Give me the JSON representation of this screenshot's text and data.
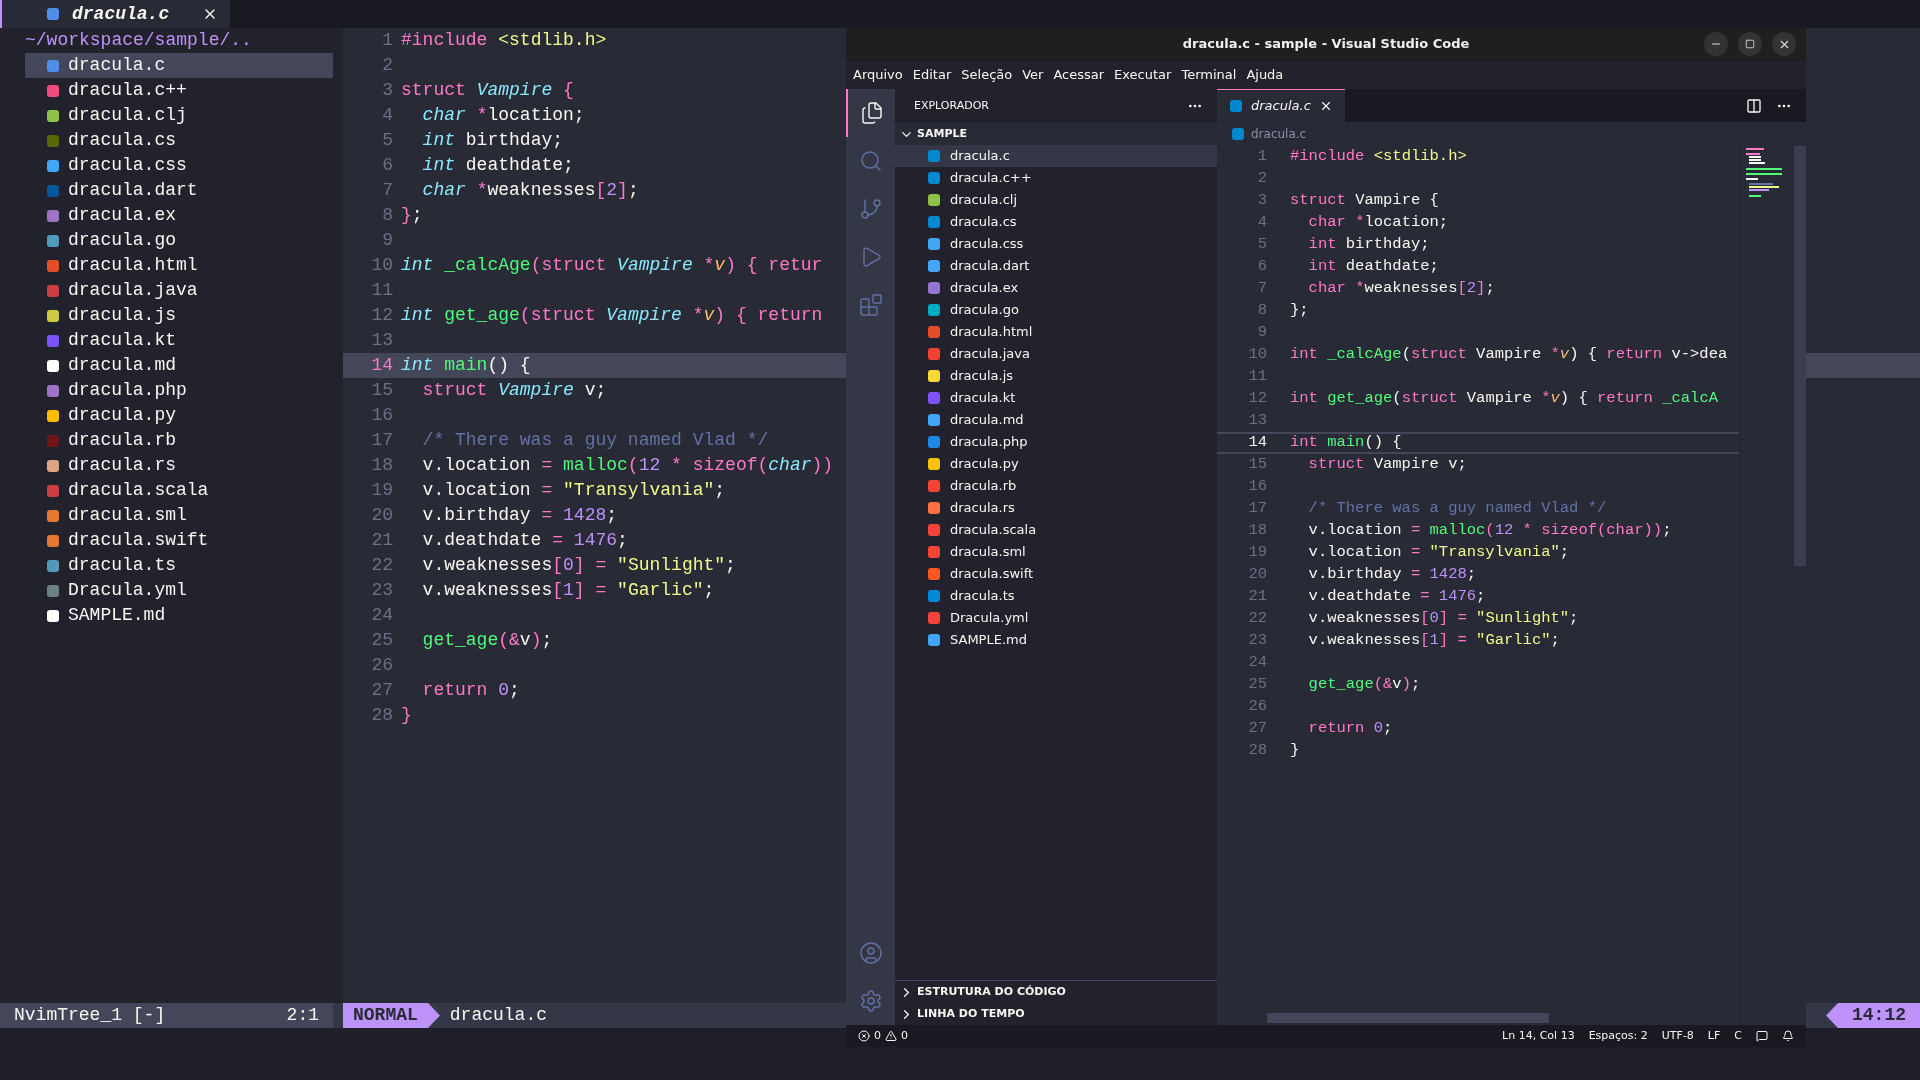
{
  "nvim": {
    "tab": {
      "title": "dracula.c"
    },
    "tree": {
      "root": "~/workspace/sample/..",
      "items": [
        {
          "name": "dracula.c",
          "color": "#4f8fe8",
          "selected": true
        },
        {
          "name": "dracula.c++",
          "color": "#f34b7d",
          "selected": false
        },
        {
          "name": "dracula.clj",
          "color": "#8dc149",
          "selected": false
        },
        {
          "name": "dracula.cs",
          "color": "#596706",
          "selected": false
        },
        {
          "name": "dracula.css",
          "color": "#42a5f5",
          "selected": false
        },
        {
          "name": "dracula.dart",
          "color": "#03589c",
          "selected": false
        },
        {
          "name": "dracula.ex",
          "color": "#a074c4",
          "selected": false
        },
        {
          "name": "dracula.go",
          "color": "#519aba",
          "selected": false
        },
        {
          "name": "dracula.html",
          "color": "#e44d26",
          "selected": false
        },
        {
          "name": "dracula.java",
          "color": "#cc3e44",
          "selected": false
        },
        {
          "name": "dracula.js",
          "color": "#cbcb41",
          "selected": false
        },
        {
          "name": "dracula.kt",
          "color": "#7f52ff",
          "selected": false
        },
        {
          "name": "dracula.md",
          "color": "#ffffff",
          "selected": false
        },
        {
          "name": "dracula.php",
          "color": "#a074c4",
          "selected": false
        },
        {
          "name": "dracula.py",
          "color": "#ffbc03",
          "selected": false
        },
        {
          "name": "dracula.rb",
          "color": "#701516",
          "selected": false
        },
        {
          "name": "dracula.rs",
          "color": "#dea584",
          "selected": false
        },
        {
          "name": "dracula.scala",
          "color": "#cc3e44",
          "selected": false
        },
        {
          "name": "dracula.sml",
          "color": "#e37933",
          "selected": false
        },
        {
          "name": "dracula.swift",
          "color": "#e37933",
          "selected": false
        },
        {
          "name": "dracula.ts",
          "color": "#519aba",
          "selected": false
        },
        {
          "name": "Dracula.yml",
          "color": "#6d8086",
          "selected": false
        },
        {
          "name": "SAMPLE.md",
          "color": "#fffffe",
          "selected": false
        }
      ]
    },
    "lines": [
      {
        "number": "1",
        "current": false,
        "tokens": [
          {
            "kind": "keyword",
            "text": "#include"
          },
          {
            "kind": "string",
            "text": " <stdlib.h>"
          }
        ]
      },
      {
        "number": "2",
        "current": false
      },
      {
        "number": "3",
        "current": false,
        "tokens": [
          {
            "kind": "keyword",
            "text": "struct "
          },
          {
            "kind": "class",
            "text": "Vampire "
          },
          {
            "kind": "operator",
            "text": "{"
          }
        ]
      },
      {
        "number": "4",
        "current": false,
        "tokens": [
          {
            "kind": "type",
            "text": "  char "
          },
          {
            "kind": "operator",
            "text": "*"
          },
          {
            "kind": "plain",
            "text": "location;"
          }
        ]
      },
      {
        "number": "5",
        "current": false,
        "tokens": [
          {
            "kind": "type",
            "text": "  int"
          },
          {
            "kind": "plain",
            "text": " birthday;"
          }
        ]
      },
      {
        "number": "6",
        "current": false,
        "tokens": [
          {
            "kind": "type",
            "text": "  int"
          },
          {
            "kind": "plain",
            "text": " deathdate;"
          }
        ]
      },
      {
        "number": "7",
        "current": false,
        "tokens": [
          {
            "kind": "type",
            "text": "  char "
          },
          {
            "kind": "operator",
            "text": "*"
          },
          {
            "kind": "plain",
            "text": "weaknesses"
          },
          {
            "kind": "operator",
            "text": "["
          },
          {
            "kind": "number",
            "text": "2"
          },
          {
            "kind": "operator",
            "text": "]"
          },
          {
            "kind": "plain",
            "text": ";"
          }
        ]
      },
      {
        "number": "8",
        "current": false,
        "tokens": [
          {
            "kind": "operator",
            "text": "}"
          },
          {
            "kind": "plain",
            "text": ";"
          }
        ]
      },
      {
        "number": "9",
        "current": false
      },
      {
        "number": "10",
        "current": false,
        "tokens": [
          {
            "kind": "type",
            "text": "int "
          },
          {
            "kind": "function",
            "text": "_calcAge"
          },
          {
            "kind": "operator",
            "text": "("
          },
          {
            "kind": "keyword",
            "text": "struct "
          },
          {
            "kind": "class",
            "text": "Vampire "
          },
          {
            "kind": "operator",
            "text": "*"
          },
          {
            "kind": "param",
            "text": "v"
          },
          {
            "kind": "operator",
            "text": ") { "
          },
          {
            "kind": "keyword",
            "text": "retur"
          }
        ]
      },
      {
        "number": "11",
        "current": false
      },
      {
        "number": "12",
        "current": false,
        "tokens": [
          {
            "kind": "type",
            "text": "int "
          },
          {
            "kind": "function",
            "text": "get_age"
          },
          {
            "kind": "operator",
            "text": "("
          },
          {
            "kind": "keyword",
            "text": "struct "
          },
          {
            "kind": "class",
            "text": "Vampire "
          },
          {
            "kind": "operator",
            "text": "*"
          },
          {
            "kind": "param",
            "text": "v"
          },
          {
            "kind": "operator",
            "text": ") { "
          },
          {
            "kind": "keyword",
            "text": "return"
          }
        ]
      },
      {
        "number": "13",
        "current": false
      },
      {
        "number": "14",
        "current": true,
        "tokens": [
          {
            "kind": "type",
            "text": "int "
          },
          {
            "kind": "function",
            "text": "main"
          },
          {
            "kind": "plain",
            "text": "() {"
          }
        ]
      },
      {
        "number": "15",
        "current": false,
        "tokens": [
          {
            "kind": "keyword",
            "text": "  struct "
          },
          {
            "kind": "class",
            "text": "Vampire"
          },
          {
            "kind": "plain",
            "text": " v;"
          }
        ]
      },
      {
        "number": "16",
        "current": false
      },
      {
        "number": "17",
        "current": false,
        "tokens": [
          {
            "kind": "comment",
            "text": "  /* There was a guy named Vlad */"
          }
        ]
      },
      {
        "number": "18",
        "current": false,
        "tokens": [
          {
            "kind": "plain",
            "text": "  v.location "
          },
          {
            "kind": "operator",
            "text": "= "
          },
          {
            "kind": "function",
            "text": "malloc"
          },
          {
            "kind": "operator",
            "text": "("
          },
          {
            "kind": "number",
            "text": "12"
          },
          {
            "kind": "operator",
            "text": " * "
          },
          {
            "kind": "keyword",
            "text": "sizeof"
          },
          {
            "kind": "operator",
            "text": "("
          },
          {
            "kind": "type",
            "text": "char"
          },
          {
            "kind": "operator",
            "text": "))"
          }
        ]
      },
      {
        "number": "19",
        "current": false,
        "tokens": [
          {
            "kind": "plain",
            "text": "  v.location "
          },
          {
            "kind": "operator",
            "text": "= "
          },
          {
            "kind": "string",
            "text": "\"Transylvania\""
          },
          {
            "kind": "plain",
            "text": ";"
          }
        ]
      },
      {
        "number": "20",
        "current": false,
        "tokens": [
          {
            "kind": "plain",
            "text": "  v.birthday "
          },
          {
            "kind": "operator",
            "text": "= "
          },
          {
            "kind": "number",
            "text": "1428"
          },
          {
            "kind": "plain",
            "text": ";"
          }
        ]
      },
      {
        "number": "21",
        "current": false,
        "tokens": [
          {
            "kind": "plain",
            "text": "  v.deathdate "
          },
          {
            "kind": "operator",
            "text": "= "
          },
          {
            "kind": "number",
            "text": "1476"
          },
          {
            "kind": "plain",
            "text": ";"
          }
        ]
      },
      {
        "number": "22",
        "current": false,
        "tokens": [
          {
            "kind": "plain",
            "text": "  v.weaknesses"
          },
          {
            "kind": "operator",
            "text": "["
          },
          {
            "kind": "number",
            "text": "0"
          },
          {
            "kind": "operator",
            "text": "] = "
          },
          {
            "kind": "string",
            "text": "\"Sunlight\""
          },
          {
            "kind": "plain",
            "text": ";"
          }
        ]
      },
      {
        "number": "23",
        "current": false,
        "tokens": [
          {
            "kind": "plain",
            "text": "  v.weaknesses"
          },
          {
            "kind": "operator",
            "text": "["
          },
          {
            "kind": "number",
            "text": "1"
          },
          {
            "kind": "operator",
            "text": "] = "
          },
          {
            "kind": "string",
            "text": "\"Garlic\""
          },
          {
            "kind": "plain",
            "text": ";"
          }
        ]
      },
      {
        "number": "24",
        "current": false
      },
      {
        "number": "25",
        "current": false,
        "tokens": [
          {
            "kind": "function",
            "text": "  get_age"
          },
          {
            "kind": "operator",
            "text": "(&"
          },
          {
            "kind": "plain",
            "text": "v"
          },
          {
            "kind": "operator",
            "text": ")"
          },
          {
            "kind": "plain",
            "text": ";"
          }
        ]
      },
      {
        "number": "26",
        "current": false
      },
      {
        "number": "27",
        "current": false,
        "tokens": [
          {
            "kind": "keyword",
            "text": "  return "
          },
          {
            "kind": "number",
            "text": "0"
          },
          {
            "kind": "plain",
            "text": ";"
          }
        ]
      },
      {
        "number": "28",
        "current": false,
        "tokens": [
          {
            "kind": "operator",
            "text": "}"
          }
        ]
      }
    ],
    "status": {
      "tree_name": "NvimTree_1 [-]",
      "tree_position": "2:1",
      "mode": "NORMAL",
      "file": "dracula.c",
      "position": "14:12"
    }
  },
  "vscode": {
    "title": "dracula.c - sample - Visual Studio Code",
    "menu": [
      "Arquivo",
      "Editar",
      "Seleção",
      "Ver",
      "Acessar",
      "Executar",
      "Terminal",
      "Ajuda"
    ],
    "explorer": {
      "title": "EXPLORADOR",
      "folder": "SAMPLE",
      "expanded": true,
      "items": [
        {
          "name": "dracula.c",
          "color": "#0288d1",
          "selected": true
        },
        {
          "name": "dracula.c++",
          "color": "#0288d2",
          "selected": false
        },
        {
          "name": "dracula.clj",
          "color": "#8dc149",
          "selected": false
        },
        {
          "name": "dracula.cs",
          "color": "#0288d3",
          "selected": false
        },
        {
          "name": "dracula.css",
          "color": "#42a5f5",
          "selected": false
        },
        {
          "name": "dracula.dart",
          "color": "#42a5f6",
          "selected": false
        },
        {
          "name": "dracula.ex",
          "color": "#9575cd",
          "selected": false
        },
        {
          "name": "dracula.go",
          "color": "#00acc1",
          "selected": false
        },
        {
          "name": "dracula.html",
          "color": "#e44d26",
          "selected": false
        },
        {
          "name": "dracula.java",
          "color": "#f44336",
          "selected": false
        },
        {
          "name": "dracula.js",
          "color": "#fdd835",
          "selected": false
        },
        {
          "name": "dracula.kt",
          "color": "#7f52ff",
          "selected": false
        },
        {
          "name": "dracula.md",
          "color": "#42a5f7",
          "selected": false
        },
        {
          "name": "dracula.php",
          "color": "#1e88e5",
          "selected": false
        },
        {
          "name": "dracula.py",
          "color": "#ffc107",
          "selected": false
        },
        {
          "name": "dracula.rb",
          "color": "#f44337",
          "selected": false
        },
        {
          "name": "dracula.rs",
          "color": "#ff7043",
          "selected": false
        },
        {
          "name": "dracula.scala",
          "color": "#f44338",
          "selected": false
        },
        {
          "name": "dracula.sml",
          "color": "#f44339",
          "selected": false
        },
        {
          "name": "dracula.swift",
          "color": "#ff5722",
          "selected": false
        },
        {
          "name": "dracula.ts",
          "color": "#0288d4",
          "selected": false
        },
        {
          "name": "Dracula.yml",
          "color": "#f4433a",
          "selected": false
        },
        {
          "name": "SAMPLE.md",
          "color": "#42a5f8",
          "selected": false
        }
      ]
    },
    "sections": [
      {
        "label": "ESTRUTURA DO CÓDIGO",
        "expanded": false
      },
      {
        "label": "LINHA DO TEMPO",
        "expanded": false
      }
    ],
    "tab": {
      "title": "dracula.c"
    },
    "breadcrumb": "dracula.c",
    "lines": [
      {
        "number": "1",
        "current": false,
        "tokens": [
          {
            "kind": "keyword",
            "text": "#include"
          },
          {
            "kind": "string",
            "text": " <stdlib.h>"
          }
        ]
      },
      {
        "number": "2",
        "current": false
      },
      {
        "number": "3",
        "current": false,
        "tokens": [
          {
            "kind": "keyword",
            "text": "struct "
          },
          {
            "kind": "class",
            "text": "Vampire {"
          }
        ]
      },
      {
        "number": "4",
        "current": false,
        "tokens": [
          {
            "kind": "type",
            "text": "  char "
          },
          {
            "kind": "operator",
            "text": "*"
          },
          {
            "kind": "plain",
            "text": "location;"
          }
        ]
      },
      {
        "number": "5",
        "current": false,
        "tokens": [
          {
            "kind": "type",
            "text": "  int"
          },
          {
            "kind": "plain",
            "text": " birthday;"
          }
        ]
      },
      {
        "number": "6",
        "current": false,
        "tokens": [
          {
            "kind": "type",
            "text": "  int"
          },
          {
            "kind": "plain",
            "text": " deathdate;"
          }
        ]
      },
      {
        "number": "7",
        "current": false,
        "tokens": [
          {
            "kind": "type",
            "text": "  char "
          },
          {
            "kind": "operator",
            "text": "*"
          },
          {
            "kind": "plain",
            "text": "weaknesses"
          },
          {
            "kind": "operator",
            "text": "["
          },
          {
            "kind": "number",
            "text": "2"
          },
          {
            "kind": "operator",
            "text": "]"
          },
          {
            "kind": "plain",
            "text": ";"
          }
        ]
      },
      {
        "number": "8",
        "current": false,
        "tokens": [
          {
            "kind": "plain",
            "text": "};"
          }
        ]
      },
      {
        "number": "9",
        "current": false
      },
      {
        "number": "10",
        "current": false,
        "tokens": [
          {
            "kind": "type",
            "text": "int "
          },
          {
            "kind": "function",
            "text": "_calcAge"
          },
          {
            "kind": "plain",
            "text": "("
          },
          {
            "kind": "keyword",
            "text": "struct "
          },
          {
            "kind": "class",
            "text": "Vampire "
          },
          {
            "kind": "operator",
            "text": "*"
          },
          {
            "kind": "param",
            "text": "v"
          },
          {
            "kind": "plain",
            "text": ") { "
          },
          {
            "kind": "keyword",
            "text": "return"
          },
          {
            "kind": "plain",
            "text": " v->dea"
          }
        ]
      },
      {
        "number": "11",
        "current": false
      },
      {
        "number": "12",
        "current": false,
        "tokens": [
          {
            "kind": "type",
            "text": "int "
          },
          {
            "kind": "function",
            "text": "get_age"
          },
          {
            "kind": "plain",
            "text": "("
          },
          {
            "kind": "keyword",
            "text": "struct "
          },
          {
            "kind": "class",
            "text": "Vampire "
          },
          {
            "kind": "operator",
            "text": "*"
          },
          {
            "kind": "param",
            "text": "v"
          },
          {
            "kind": "plain",
            "text": ") { "
          },
          {
            "kind": "keyword",
            "text": "return "
          },
          {
            "kind": "function",
            "text": "_calcA"
          }
        ]
      },
      {
        "number": "13",
        "current": false
      },
      {
        "number": "14",
        "current": true,
        "tokens": [
          {
            "kind": "type",
            "text": "int "
          },
          {
            "kind": "function",
            "text": "main"
          },
          {
            "kind": "plain",
            "text": "() {"
          }
        ]
      },
      {
        "number": "15",
        "current": false,
        "tokens": [
          {
            "kind": "keyword",
            "text": "  struct "
          },
          {
            "kind": "class",
            "text": "Vampire"
          },
          {
            "kind": "plain",
            "text": " v;"
          }
        ]
      },
      {
        "number": "16",
        "current": false
      },
      {
        "number": "17",
        "current": false,
        "tokens": [
          {
            "kind": "comment",
            "text": "  /* There was a guy named Vlad */"
          }
        ]
      },
      {
        "number": "18",
        "current": false,
        "tokens": [
          {
            "kind": "plain",
            "text": "  v.location "
          },
          {
            "kind": "operator",
            "text": "= "
          },
          {
            "kind": "function",
            "text": "malloc"
          },
          {
            "kind": "operator",
            "text": "("
          },
          {
            "kind": "number",
            "text": "12"
          },
          {
            "kind": "operator",
            "text": " * "
          },
          {
            "kind": "keyword",
            "text": "sizeof"
          },
          {
            "kind": "operator",
            "text": "("
          },
          {
            "kind": "keyword",
            "text": "char"
          },
          {
            "kind": "operator",
            "text": "))"
          },
          {
            "kind": "plain",
            "text": ";"
          }
        ]
      },
      {
        "number": "19",
        "current": false,
        "tokens": [
          {
            "kind": "plain",
            "text": "  v.location "
          },
          {
            "kind": "operator",
            "text": "= "
          },
          {
            "kind": "string",
            "text": "\"Transylvania\""
          },
          {
            "kind": "plain",
            "text": ";"
          }
        ]
      },
      {
        "number": "20",
        "current": false,
        "tokens": [
          {
            "kind": "plain",
            "text": "  v.birthday "
          },
          {
            "kind": "operator",
            "text": "= "
          },
          {
            "kind": "number",
            "text": "1428"
          },
          {
            "kind": "plain",
            "text": ";"
          }
        ]
      },
      {
        "number": "21",
        "current": false,
        "tokens": [
          {
            "kind": "plain",
            "text": "  v.deathdate "
          },
          {
            "kind": "operator",
            "text": "= "
          },
          {
            "kind": "number",
            "text": "1476"
          },
          {
            "kind": "plain",
            "text": ";"
          }
        ]
      },
      {
        "number": "22",
        "current": false,
        "tokens": [
          {
            "kind": "plain",
            "text": "  v.weaknesses"
          },
          {
            "kind": "operator",
            "text": "["
          },
          {
            "kind": "number",
            "text": "0"
          },
          {
            "kind": "operator",
            "text": "] = "
          },
          {
            "kind": "string",
            "text": "\"Sunlight\""
          },
          {
            "kind": "plain",
            "text": ";"
          }
        ]
      },
      {
        "number": "23",
        "current": false,
        "tokens": [
          {
            "kind": "plain",
            "text": "  v.weaknesses"
          },
          {
            "kind": "operator",
            "text": "["
          },
          {
            "kind": "number",
            "text": "1"
          },
          {
            "kind": "operator",
            "text": "] = "
          },
          {
            "kind": "string",
            "text": "\"Garlic\""
          },
          {
            "kind": "plain",
            "text": ";"
          }
        ]
      },
      {
        "number": "24",
        "current": false
      },
      {
        "number": "25",
        "current": false,
        "tokens": [
          {
            "kind": "function",
            "text": "  get_age"
          },
          {
            "kind": "operator",
            "text": "(&"
          },
          {
            "kind": "plain",
            "text": "v"
          },
          {
            "kind": "operator",
            "text": ")"
          },
          {
            "kind": "plain",
            "text": ";"
          }
        ]
      },
      {
        "number": "26",
        "current": false
      },
      {
        "number": "27",
        "current": false,
        "tokens": [
          {
            "kind": "keyword",
            "text": "  return "
          },
          {
            "kind": "number",
            "text": "0"
          },
          {
            "kind": "plain",
            "text": ";"
          }
        ]
      },
      {
        "number": "28",
        "current": false,
        "tokens": [
          {
            "kind": "plain",
            "text": "}"
          }
        ]
      }
    ],
    "status": {
      "errors": "0",
      "warnings": "0",
      "items": [
        "Ln 14, Col 13",
        "Espaços: 2",
        "UTF-8",
        "LF",
        "C"
      ]
    }
  }
}
